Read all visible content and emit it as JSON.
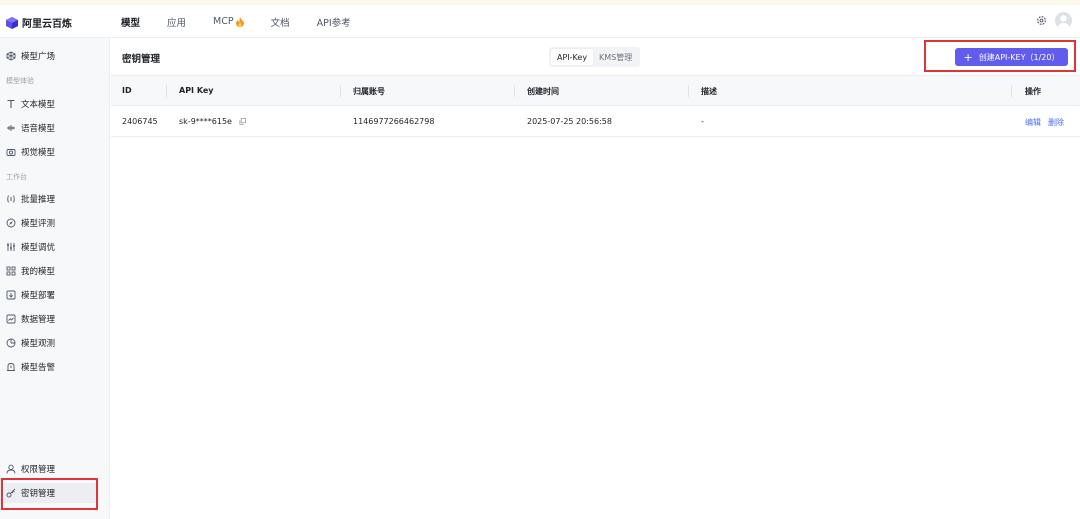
{
  "app": {
    "name": "阿里云百炼"
  },
  "topnav": {
    "items": [
      {
        "label": "模型",
        "active": true
      },
      {
        "label": "应用"
      },
      {
        "label": "MCP"
      },
      {
        "label": "文档"
      },
      {
        "label": "API参考"
      }
    ]
  },
  "sidebar": {
    "top_item": "模型广场",
    "section_experience": "模型体验",
    "experience_items": [
      "文本模型",
      "语音模型",
      "视觉模型"
    ],
    "section_workbench": "工作台",
    "workbench_items": [
      "批量推理",
      "模型评测",
      "模型调优",
      "我的模型",
      "模型部署",
      "数据管理",
      "模型观测",
      "模型告警"
    ],
    "bottom_items": [
      "权限管理",
      "密钥管理"
    ],
    "active": "密钥管理"
  },
  "page": {
    "title": "密钥管理",
    "tabs": [
      {
        "label": "API-Key",
        "active": true
      },
      {
        "label": "KMS管理"
      }
    ],
    "create_button": "创建API-KEY（1/20）"
  },
  "table": {
    "columns": [
      "ID",
      "API Key",
      "归属账号",
      "创建时间",
      "描述",
      "操作"
    ],
    "rows": [
      {
        "id": "2406745",
        "api_key": "sk-9****615e",
        "account": "1146977266462798",
        "created": "2025-07-25 20:56:58",
        "description": "-",
        "actions": [
          "编辑",
          "删除"
        ]
      }
    ]
  },
  "colors": {
    "primary": "#615ced",
    "link": "#4b6ef5",
    "highlight": "#e0343b",
    "sidebar_bg": "#f7f8fa"
  }
}
